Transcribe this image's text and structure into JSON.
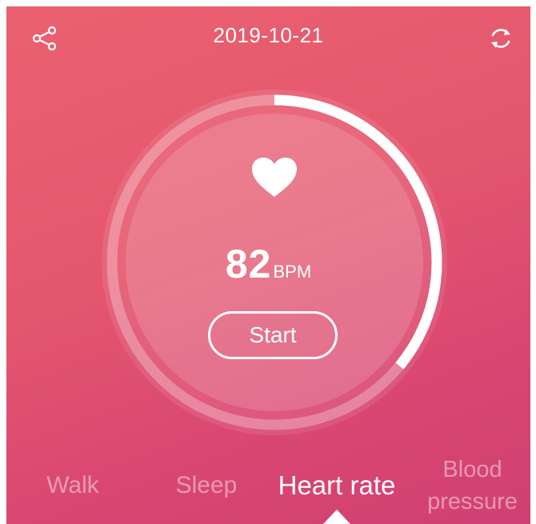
{
  "header": {
    "date": "2019-10-21",
    "share_icon": "share-icon",
    "refresh_icon": "refresh-icon"
  },
  "measurement": {
    "value": "82",
    "unit": "BPM",
    "start_label": "Start",
    "progress_fraction": 0.36,
    "icon": "heart-icon"
  },
  "tabs": {
    "walk": "Walk",
    "sleep": "Sleep",
    "heart_rate": "Heart rate",
    "blood_line1": "Blood",
    "blood_line2": "pressure",
    "active": "Heart rate"
  },
  "colors": {
    "gradient_top": "#eb6170",
    "gradient_bottom": "#d14073",
    "foreground": "#ffffff"
  }
}
